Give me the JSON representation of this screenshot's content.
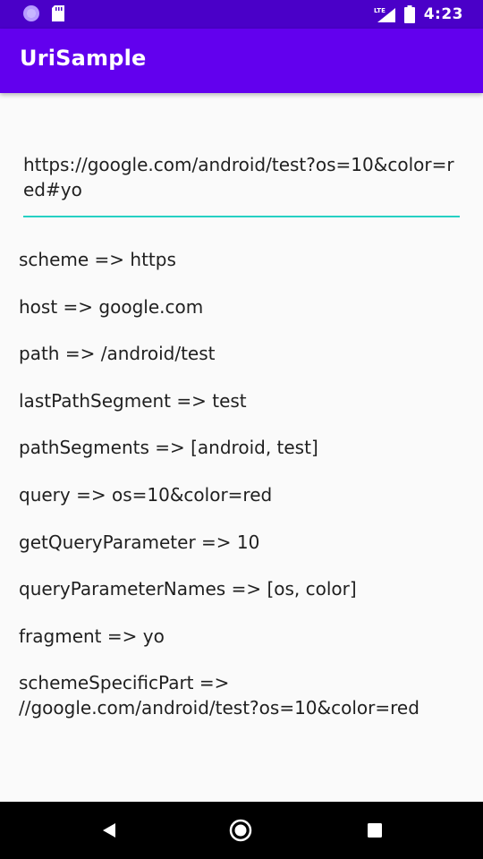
{
  "status_bar": {
    "time": "4:23",
    "network": "LTE",
    "icons": [
      "sync-icon",
      "sd-card-icon",
      "lte-signal-icon",
      "battery-icon"
    ]
  },
  "app_bar": {
    "title": "UriSample",
    "color": "#6200ee"
  },
  "input": {
    "value": "https://google.com/android/test?os=10&color=red#yo",
    "underline_color": "#26d0c3"
  },
  "results": [
    "scheme => https",
    "host => google.com",
    "path => /android/test",
    "lastPathSegment => test",
    "pathSegments => [android, test]",
    "query => os=10&color=red",
    "getQueryParameter => 10",
    "queryParameterNames => [os, color]",
    "fragment => yo",
    "schemeSpecificPart => //google.com/android/test?os=10&color=red"
  ],
  "navigation": {
    "buttons": [
      "back-icon",
      "home-icon",
      "recents-icon"
    ]
  }
}
